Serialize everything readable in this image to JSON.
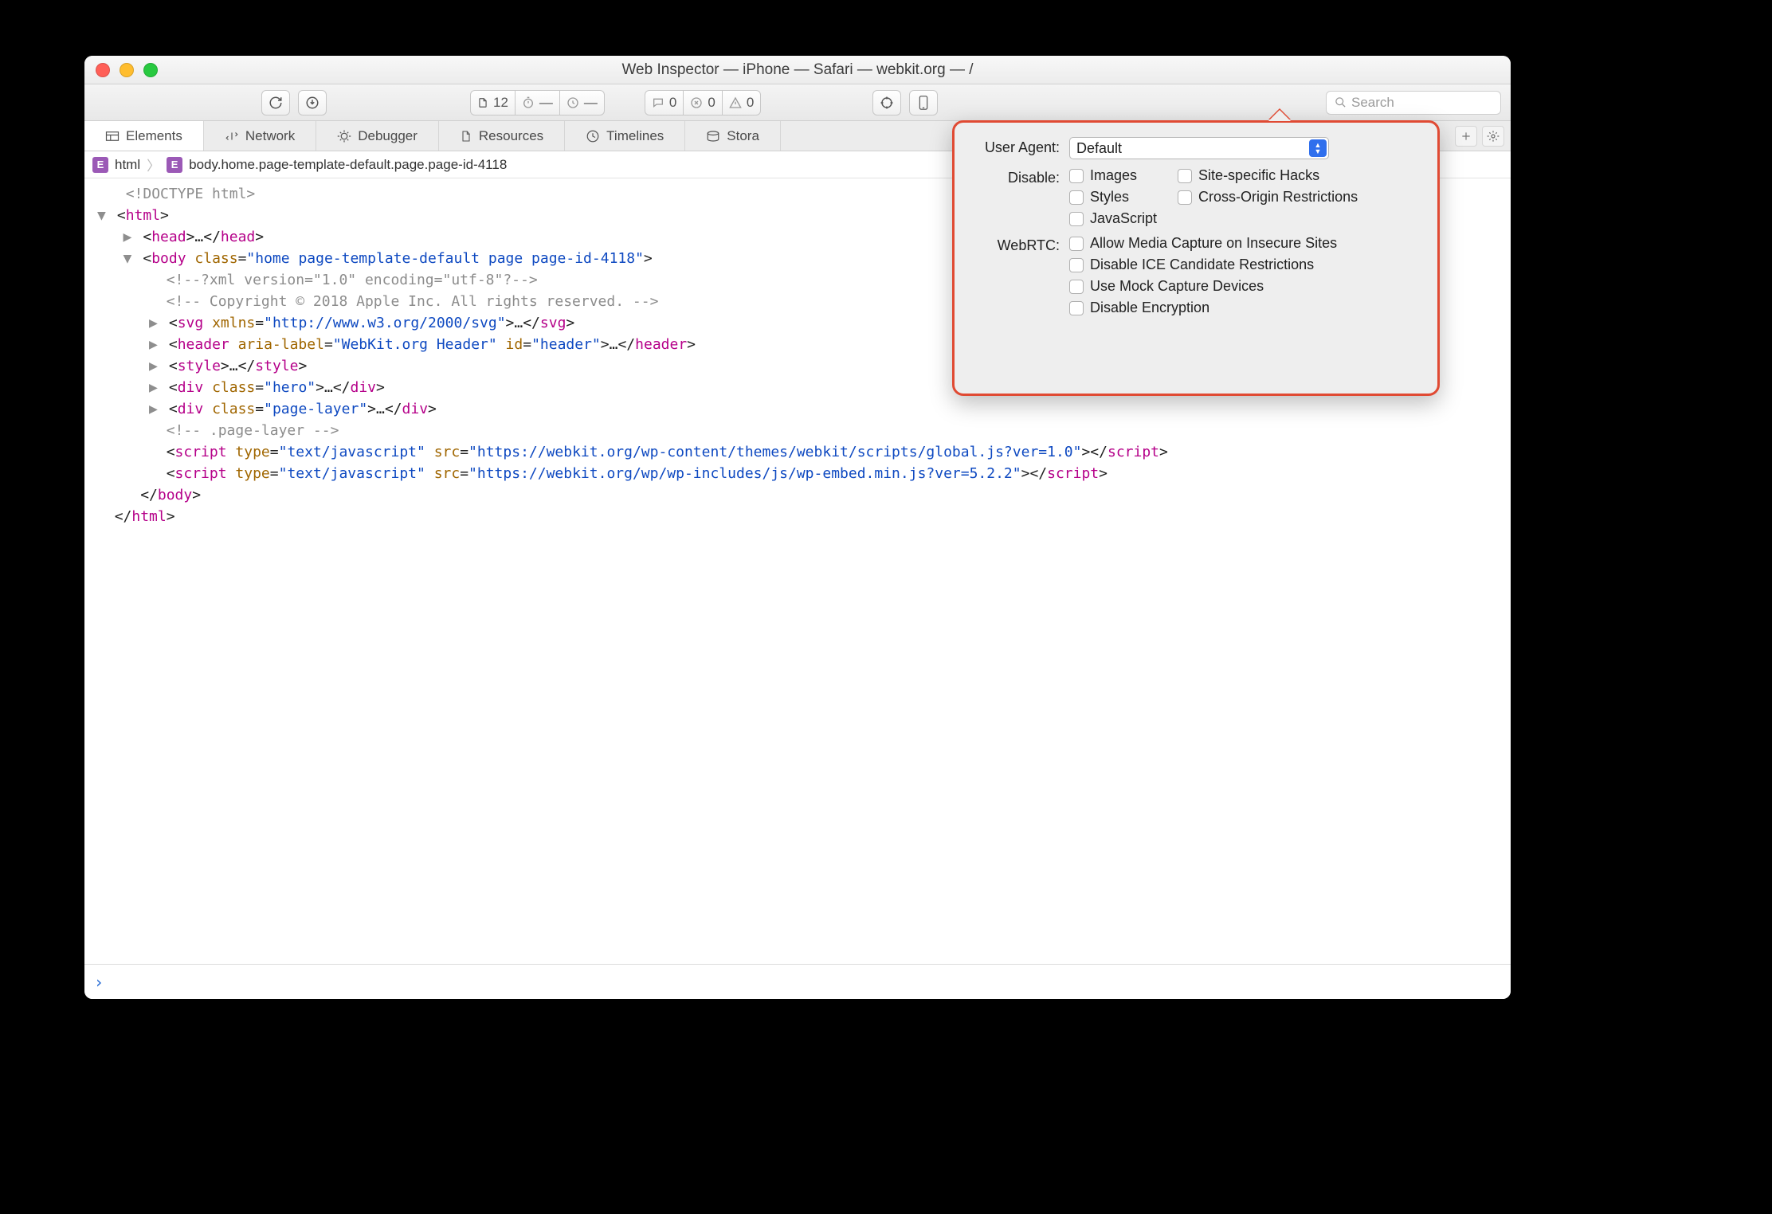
{
  "window": {
    "title": "Web Inspector — iPhone — Safari — webkit.org — /"
  },
  "toolbar": {
    "file_count": "12",
    "timer_count": "—",
    "errors_count": "0",
    "issues_count": "0",
    "warnings_count": "0",
    "search_placeholder": "Search"
  },
  "tabs": [
    {
      "id": "elements",
      "label": "Elements"
    },
    {
      "id": "network",
      "label": "Network"
    },
    {
      "id": "debugger",
      "label": "Debugger"
    },
    {
      "id": "resources",
      "label": "Resources"
    },
    {
      "id": "timelines",
      "label": "Timelines"
    },
    {
      "id": "storage",
      "label": "Stora"
    }
  ],
  "breadcrumb": {
    "first": "html",
    "second": "body.home.page-template-default.page.page-id-4118"
  },
  "popover": {
    "ua_label": "User Agent:",
    "ua_value": "Default",
    "disable_label": "Disable:",
    "disable_left": [
      "Images",
      "Styles",
      "JavaScript"
    ],
    "disable_right": [
      "Site-specific Hacks",
      "Cross-Origin Restrictions"
    ],
    "webrtc_label": "WebRTC:",
    "webrtc_items": [
      "Allow Media Capture on Insecure Sites",
      "Disable ICE Candidate Restrictions",
      "Use Mock Capture Devices",
      "Disable Encryption"
    ]
  },
  "src_lines": {
    "l0": "<!DOCTYPE html>",
    "l1a": "<",
    "l1b": "html",
    "l1c": ">",
    "l2a": "<",
    "l2b": "head",
    "l2c": ">…</",
    "l2d": "head",
    "l2e": ">",
    "l3a": "<",
    "l3b": "body ",
    "l3attr": "class",
    "l3eq": "=",
    "l3val": "\"home page-template-default page page-id-4118\"",
    "l3c": ">",
    "l4": "<!--?xml version=\"1.0\" encoding=\"utf-8\"?-->",
    "l5": "<!-- Copyright © 2018 Apple Inc. All rights reserved. -->",
    "l6a": "<",
    "l6b": "svg ",
    "l6attr": "xmlns",
    "l6eq": "=",
    "l6val": "\"http://www.w3.org/2000/svg\"",
    "l6c": ">…</",
    "l6d": "svg",
    "l6e": ">",
    "l7a": "<",
    "l7b": "header ",
    "l7attr1": "aria-label",
    "l7eq": "=",
    "l7val1": "\"WebKit.org Header\" ",
    "l7attr2": "id",
    "l7val2": "\"header\"",
    "l7c": ">…</",
    "l7d": "header",
    "l7e": ">",
    "l8a": "<",
    "l8b": "style",
    "l8c": ">…</",
    "l8d": "style",
    "l8e": ">",
    "l9a": "<",
    "l9b": "div ",
    "l9attr": "class",
    "l9eq": "=",
    "l9val": "\"hero\"",
    "l9c": ">…</",
    "l9d": "div",
    "l9e": ">",
    "l10a": "<",
    "l10b": "div ",
    "l10attr": "class",
    "l10eq": "=",
    "l10val": "\"page-layer\"",
    "l10c": ">…</",
    "l10d": "div",
    "l10e": ">",
    "l11": "<!-- .page-layer -->",
    "l12a": "<",
    "l12b": "script ",
    "l12attr1": "type",
    "l12eq": "=",
    "l12val1": "\"text/javascript\" ",
    "l12attr2": "src",
    "l12val2": "\"https://webkit.org/wp-content/themes/webkit/scripts/global.js?ver=1.0\"",
    "l12c": "></",
    "l12d": "script",
    "l12e": ">",
    "l13a": "<",
    "l13b": "script ",
    "l13attr1": "type",
    "l13eq": "=",
    "l13val1": "\"text/javascript\" ",
    "l13attr2": "src",
    "l13val2": "\"https://webkit.org/wp/wp-includes/js/wp-embed.min.js?ver=5.2.2\"",
    "l13c": "></",
    "l13d": "script",
    "l13e": ">",
    "l14a": "</",
    "l14b": "body",
    "l14c": ">",
    "l15a": "</",
    "l15b": "html",
    "l15c": ">"
  },
  "prompt": "›"
}
